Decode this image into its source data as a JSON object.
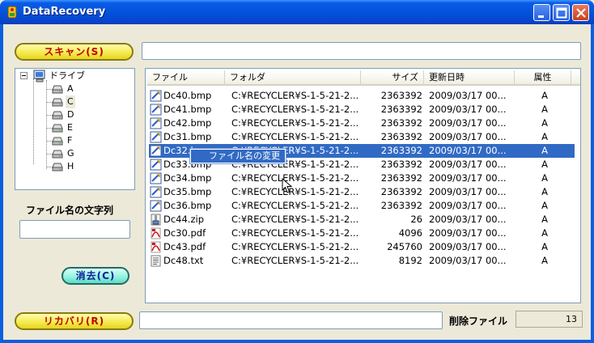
{
  "window": {
    "title": "DataRecovery"
  },
  "buttons": {
    "scan": "スキャン(S)",
    "clear": "消去(C)",
    "recover": "リカバリ(R)"
  },
  "inputs": {
    "scan_path": "",
    "filename_filter": "",
    "recover_path": ""
  },
  "labels": {
    "filename_string": "ファイル名の文字列",
    "deleted_files": "削除ファイル"
  },
  "deleted_count": "13",
  "tree": {
    "root": "ドライブ",
    "drives": [
      "A",
      "C",
      "D",
      "E",
      "F",
      "G",
      "H"
    ],
    "selected": "C"
  },
  "list": {
    "columns": [
      "ファイル",
      "フォルダ",
      "サイズ",
      "更新日時",
      "属性"
    ],
    "rows": [
      {
        "name": "Dc40.bmp",
        "folder": "C:¥RECYCLER¥S-1-5-21-2...",
        "size": "2363392",
        "date": "2009/03/17 00...",
        "attr": "A",
        "icon": "bmp-icon"
      },
      {
        "name": "Dc41.bmp",
        "folder": "C:¥RECYCLER¥S-1-5-21-2...",
        "size": "2363392",
        "date": "2009/03/17 00...",
        "attr": "A",
        "icon": "bmp-icon"
      },
      {
        "name": "Dc42.bmp",
        "folder": "C:¥RECYCLER¥S-1-5-21-2...",
        "size": "2363392",
        "date": "2009/03/17 00...",
        "attr": "A",
        "icon": "bmp-icon"
      },
      {
        "name": "Dc31.bmp",
        "folder": "C:¥RECYCLER¥S-1-5-21-2...",
        "size": "2363392",
        "date": "2009/03/17 00...",
        "attr": "A",
        "icon": "bmp-icon"
      },
      {
        "name": "Dc32.bmp",
        "folder": "C:¥RECYCLER¥S-1-5-21-2...",
        "size": "2363392",
        "date": "2009/03/17 00...",
        "attr": "A",
        "icon": "bmp-icon",
        "selected": true
      },
      {
        "name": "Dc33.bmp",
        "folder": "C:¥RECYCLER¥S-1-5-21-2...",
        "size": "2363392",
        "date": "2009/03/17 00...",
        "attr": "A",
        "icon": "bmp-icon"
      },
      {
        "name": "Dc34.bmp",
        "folder": "C:¥RECYCLER¥S-1-5-21-2...",
        "size": "2363392",
        "date": "2009/03/17 00...",
        "attr": "A",
        "icon": "bmp-icon"
      },
      {
        "name": "Dc35.bmp",
        "folder": "C:¥RECYCLER¥S-1-5-21-2...",
        "size": "2363392",
        "date": "2009/03/17 00...",
        "attr": "A",
        "icon": "bmp-icon"
      },
      {
        "name": "Dc36.bmp",
        "folder": "C:¥RECYCLER¥S-1-5-21-2...",
        "size": "2363392",
        "date": "2009/03/17 00...",
        "attr": "A",
        "icon": "bmp-icon"
      },
      {
        "name": "Dc44.zip",
        "folder": "C:¥RECYCLER¥S-1-5-21-2...",
        "size": "26",
        "date": "2009/03/17 00...",
        "attr": "A",
        "icon": "zip-icon"
      },
      {
        "name": "Dc30.pdf",
        "folder": "C:¥RECYCLER¥S-1-5-21-2...",
        "size": "4096",
        "date": "2009/03/17 00...",
        "attr": "A",
        "icon": "pdf-icon"
      },
      {
        "name": "Dc43.pdf",
        "folder": "C:¥RECYCLER¥S-1-5-21-2...",
        "size": "245760",
        "date": "2009/03/17 00...",
        "attr": "A",
        "icon": "pdf-icon"
      },
      {
        "name": "Dc48.txt",
        "folder": "C:¥RECYCLER¥S-1-5-21-2...",
        "size": "8192",
        "date": "2009/03/17 00...",
        "attr": "A",
        "icon": "txt-icon"
      }
    ]
  },
  "context_menu": {
    "items": [
      "ファイル名の変更"
    ]
  },
  "colors": {
    "selection": "#316ac5",
    "titlebar": "#0a5ce6",
    "pill_text": "#c00000"
  }
}
